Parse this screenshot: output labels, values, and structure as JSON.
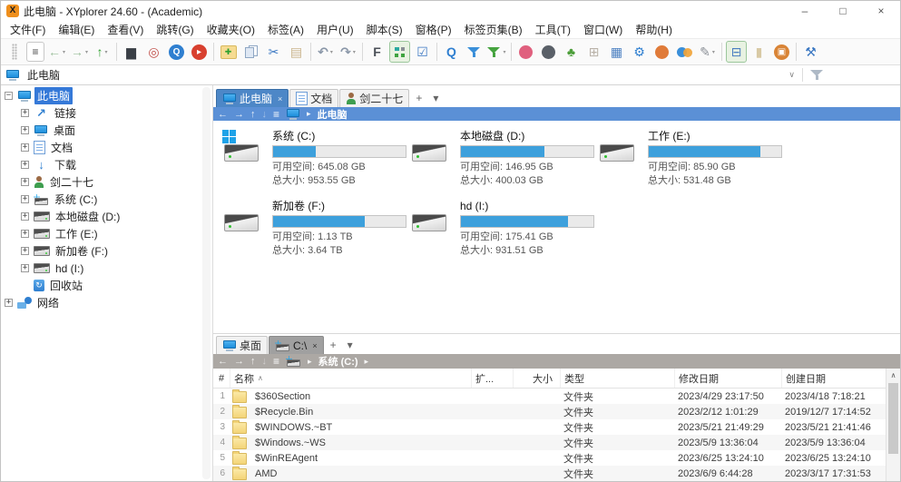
{
  "window": {
    "title": "此电脑 - XYplorer 24.60 - (Academic)",
    "controls": {
      "minimize": "–",
      "maximize": "□",
      "close": "×"
    }
  },
  "menubar": {
    "items": [
      "文件(F)",
      "编辑(E)",
      "查看(V)",
      "跳转(G)",
      "收藏夹(O)",
      "标签(A)",
      "用户(U)",
      "脚本(S)",
      "窗格(P)",
      "标签页集(B)",
      "工具(T)",
      "窗口(W)",
      "帮助(H)"
    ]
  },
  "toolbar": {
    "groups": [
      [
        {
          "name": "toolbar-grip",
          "shape": "grip"
        },
        {
          "name": "list-menu-button",
          "glyph": "≡",
          "color": "#444444",
          "boxed": true
        },
        {
          "name": "back-button",
          "glyph": "←",
          "color": "#9bbf9b",
          "bold": true,
          "caret": true
        },
        {
          "name": "forward-button",
          "glyph": "→",
          "color": "#9bbf9b",
          "bold": true,
          "caret": true
        },
        {
          "name": "up-button",
          "glyph": "↑",
          "color": "#2fa12f",
          "bold": true,
          "caret": true
        }
      ],
      [
        {
          "name": "mini-tree-monitor-button",
          "glyph": "▆",
          "color": "#3a3f46"
        },
        {
          "name": "catalog-target-button",
          "glyph": "◎",
          "color": "#c2504a",
          "bold": true
        },
        {
          "name": "zoom-lens-button",
          "glyph": "Q",
          "color": "#ffffff",
          "circle": "#2f7fd0"
        },
        {
          "name": "go-button",
          "glyph": "▸",
          "color": "#ffffff",
          "circle": "#d8402f"
        }
      ],
      [
        {
          "name": "new-folder-button",
          "glyph": "✚",
          "color": "#2fa12f",
          "chip": "#f6db92"
        },
        {
          "name": "copy-button",
          "shape": "copy"
        },
        {
          "name": "cut-button",
          "glyph": "✂",
          "color": "#3a77c2"
        },
        {
          "name": "paste-button",
          "glyph": "▤",
          "color": "#c9b48b"
        }
      ],
      [
        {
          "name": "undo-button",
          "glyph": "↶",
          "color": "#8a97a8",
          "bold": true,
          "caret": true
        },
        {
          "name": "redo-button",
          "glyph": "↷",
          "color": "#8a97a8",
          "bold": true,
          "caret": true
        }
      ],
      [
        {
          "name": "flat-view-button",
          "glyph": "F",
          "color": "#4a4f57",
          "bold": true
        },
        {
          "name": "show-mini-tree-button",
          "shape": "minitree",
          "pressed": true
        },
        {
          "name": "checkbox-selection-button",
          "glyph": "☑",
          "color": "#3a77c2"
        }
      ],
      [
        {
          "name": "find-files-button",
          "glyph": "Q",
          "color": "#2f7fd0",
          "bold": true
        },
        {
          "name": "filter-button",
          "shape": "funnel",
          "color": "#3a8fd9"
        },
        {
          "name": "visual-filter-button",
          "shape": "funnel",
          "color": "#45a33f",
          "caret": true
        }
      ],
      [
        {
          "name": "lollipop-button",
          "shape": "dot",
          "color": "#e0607e"
        },
        {
          "name": "dark-sphere-button",
          "shape": "dot",
          "color": "#5a6068"
        },
        {
          "name": "tree-plant-button",
          "glyph": "♣",
          "color": "#4d9e3a"
        },
        {
          "name": "tile-grid-button",
          "glyph": "⊞",
          "color": "#b9b2a8"
        },
        {
          "name": "mixer-button",
          "glyph": "▦",
          "color": "#4a7fc1"
        },
        {
          "name": "gear-button",
          "glyph": "⚙",
          "color": "#2f7fd0"
        },
        {
          "name": "basketball-button",
          "shape": "dot",
          "color": "#e07b39"
        },
        {
          "name": "color-circles-button",
          "shape": "dots2",
          "c1": "#3a8fd9",
          "c2": "#f0a43a"
        },
        {
          "name": "brush-button",
          "glyph": "✎",
          "color": "#8a8f96",
          "caret": true
        }
      ],
      [
        {
          "name": "dual-pane-button",
          "glyph": "⊟",
          "color": "#4a7fc1",
          "pressed": true
        },
        {
          "name": "single-pane-button",
          "glyph": "▮",
          "color": "#d8c9a4"
        },
        {
          "name": "viewer-button",
          "glyph": "▣",
          "color": "#ffffff",
          "circle": "#d98436"
        }
      ],
      [
        {
          "name": "tools-button",
          "glyph": "⚒",
          "color": "#3a77c2"
        }
      ]
    ]
  },
  "addressbar": {
    "value": "此电脑",
    "dropdown_glyph": "∨"
  },
  "breadcrumb_glyphs": {
    "arrows": [
      "←",
      "→",
      "↑",
      "↓"
    ],
    "menu": "≡",
    "sep": "▸"
  },
  "icons": {
    "computer": {
      "shape": "computer"
    },
    "desktop": {
      "shape": "computer"
    },
    "document": {
      "shape": "document"
    },
    "link": {
      "glyph": "↗",
      "color": "#2f7fd0"
    },
    "download": {
      "glyph": "↓",
      "color": "#2f7fd0"
    },
    "user": {
      "shape": "user"
    },
    "drive": {
      "shape": "drive"
    },
    "drive-win": {
      "shape": "drive-win"
    },
    "recycle": {
      "shape": "recycle"
    },
    "network": {
      "shape": "network"
    },
    "folder": {
      "shape": "folder"
    }
  },
  "tree": {
    "items": [
      {
        "label": "此电脑",
        "icon": "computer",
        "level": 0,
        "exp": "−",
        "selected": true
      },
      {
        "label": "链接",
        "icon": "link",
        "level": 1,
        "exp": "+"
      },
      {
        "label": "桌面",
        "icon": "desktop",
        "level": 1,
        "exp": "+"
      },
      {
        "label": "文档",
        "icon": "document",
        "level": 1,
        "exp": "+"
      },
      {
        "label": "下载",
        "icon": "download",
        "level": 1,
        "exp": "+"
      },
      {
        "label": "剑二十七",
        "icon": "user",
        "level": 1,
        "exp": "+"
      },
      {
        "label": "系统 (C:)",
        "icon": "drive-win",
        "level": 1,
        "exp": "+"
      },
      {
        "label": "本地磁盘 (D:)",
        "icon": "drive",
        "level": 1,
        "exp": "+"
      },
      {
        "label": "工作 (E:)",
        "icon": "drive",
        "level": 1,
        "exp": "+"
      },
      {
        "label": "新加卷 (F:)",
        "icon": "drive",
        "level": 1,
        "exp": "+"
      },
      {
        "label": "hd (I:)",
        "icon": "drive",
        "level": 1,
        "exp": "+"
      },
      {
        "label": "回收站",
        "icon": "recycle",
        "level": 1,
        "exp": ""
      },
      {
        "label": "网络",
        "icon": "network",
        "level": 0,
        "exp": "+"
      }
    ]
  },
  "panes": {
    "top": {
      "tabs": [
        {
          "label": "此电脑",
          "icon": "computer",
          "active": true,
          "close": "×"
        },
        {
          "label": "文档",
          "icon": "document"
        },
        {
          "label": "剑二十七",
          "icon": "user"
        }
      ],
      "new_tab": "+",
      "tab_menu": "▾",
      "breadcrumb": {
        "icon": "computer",
        "path": "此电脑",
        "trailing": false
      },
      "drives": [
        {
          "name": "系统 (C:)",
          "icon": "drive-win",
          "used_pct": 32,
          "free": "可用空间: 645.08 GB",
          "total": "总大小: 953.55 GB"
        },
        {
          "name": "本地磁盘 (D:)",
          "icon": "drive",
          "used_pct": 63,
          "free": "可用空间: 146.95 GB",
          "total": "总大小: 400.03 GB"
        },
        {
          "name": "工作 (E:)",
          "icon": "drive",
          "used_pct": 84,
          "free": "可用空间: 85.90 GB",
          "total": "总大小: 531.48 GB"
        },
        {
          "name": "新加卷 (F:)",
          "icon": "drive",
          "used_pct": 69,
          "free": "可用空间: 1.13 TB",
          "total": "总大小: 3.64 TB"
        },
        {
          "name": "hd (I:)",
          "icon": "drive",
          "used_pct": 81,
          "free": "可用空间: 175.41 GB",
          "total": "总大小: 931.51 GB"
        }
      ]
    },
    "bottom": {
      "tabs": [
        {
          "label": "桌面",
          "icon": "desktop"
        },
        {
          "label": "C:\\",
          "icon": "drive-win",
          "active": true,
          "close": "×"
        }
      ],
      "new_tab": "+",
      "tab_menu": "▾",
      "breadcrumb": {
        "icon": "drive-win",
        "path": "系统 (C:)",
        "trailing": true
      },
      "table": {
        "headers": {
          "index": "#",
          "name": "名称",
          "sort": "∧",
          "ext": "扩...",
          "size": "大小",
          "type": "类型",
          "modified": "修改日期",
          "created": "创建日期"
        },
        "scroll_up": "∧",
        "rows": [
          {
            "n": "1",
            "name": "$360Section",
            "ext": "",
            "size": "",
            "type": "文件夹",
            "modified": "2023/4/29 23:17:50",
            "created": "2023/4/18 7:18:21"
          },
          {
            "n": "2",
            "name": "$Recycle.Bin",
            "ext": "",
            "size": "",
            "type": "文件夹",
            "modified": "2023/2/12 1:01:29",
            "created": "2019/12/7 17:14:52"
          },
          {
            "n": "3",
            "name": "$WINDOWS.~BT",
            "ext": "",
            "size": "",
            "type": "文件夹",
            "modified": "2023/5/21 21:49:29",
            "created": "2023/5/21 21:41:46"
          },
          {
            "n": "4",
            "name": "$Windows.~WS",
            "ext": "",
            "size": "",
            "type": "文件夹",
            "modified": "2023/5/9 13:36:04",
            "created": "2023/5/9 13:36:04"
          },
          {
            "n": "5",
            "name": "$WinREAgent",
            "ext": "",
            "size": "",
            "type": "文件夹",
            "modified": "2023/6/25 13:24:10",
            "created": "2023/6/25 13:24:10"
          },
          {
            "n": "6",
            "name": "AMD",
            "ext": "",
            "size": "",
            "type": "文件夹",
            "modified": "2023/6/9 6:44:28",
            "created": "2023/3/17 17:31:53"
          }
        ]
      }
    }
  }
}
